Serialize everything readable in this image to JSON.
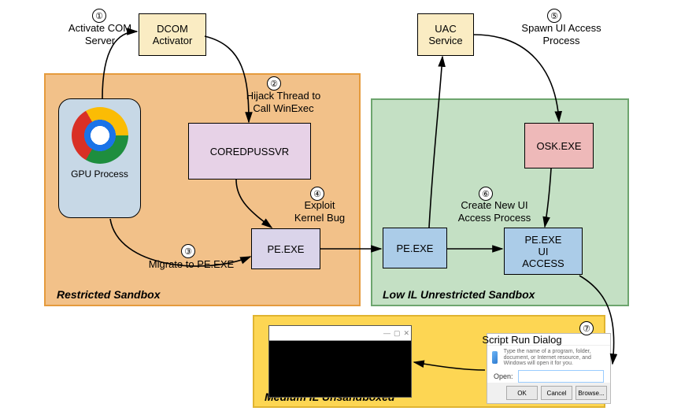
{
  "steps": {
    "s1": {
      "num": "①",
      "label": "Activate COM\nServer"
    },
    "s2": {
      "num": "②",
      "label": "Hijack Thread to\nCall WinExec"
    },
    "s3": {
      "num": "③",
      "label": "Migrate to PE.EXE"
    },
    "s4": {
      "num": "④",
      "label": "Exploit\nKernel Bug"
    },
    "s5": {
      "num": "⑤",
      "label": "Spawn UI Access\nProcess"
    },
    "s6": {
      "num": "⑥",
      "label": "Create New UI\nAccess Process"
    },
    "s7": {
      "num": "⑦",
      "label": "Script Run Dialog"
    }
  },
  "nodes": {
    "dcom": "DCOM\nActivator",
    "uac": "UAC\nService",
    "coredpuss": "COREDPUSSVR",
    "pe1": "PE.EXE",
    "pe2": "PE.EXE",
    "pe3": "PE.EXE\nUI\nACCESS",
    "osk": "OSK.EXE",
    "gpu": "GPU Process"
  },
  "sandboxes": {
    "restricted": "Restricted Sandbox",
    "low": "Low IL Unrestricted Sandbox",
    "medium": "Medium IL Unsandboxed"
  },
  "dialog": {
    "hint": "Type the name of a program, folder, document, or Internet resource, and Windows will open it for you.",
    "open": "Open:",
    "ok": "OK",
    "cancel": "Cancel",
    "browse": "Browse..."
  }
}
